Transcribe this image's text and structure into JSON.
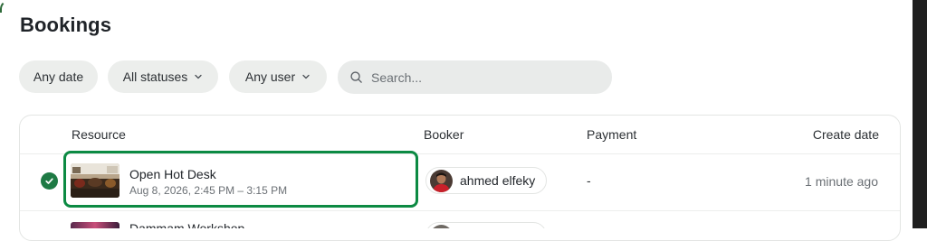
{
  "page": {
    "title": "Bookings"
  },
  "filters": {
    "date_label": "Any date",
    "status_label": "All statuses",
    "user_label": "Any user",
    "search_placeholder": "Search...",
    "search_value": ""
  },
  "table": {
    "headers": {
      "resource": "Resource",
      "booker": "Booker",
      "payment": "Payment",
      "create_date": "Create date"
    },
    "rows": [
      {
        "status": "confirmed",
        "resource_name": "Open Hot Desk",
        "time": "Aug 8, 2026, 2:45 PM – 3:15 PM",
        "booker": "ahmed elfeky",
        "payment": "-",
        "created": "1 minute ago"
      },
      {
        "resource_name": "Dammam Workshop"
      }
    ]
  },
  "colors": {
    "accent_green": "#0c8a43",
    "status_green": "#1e7a44",
    "chip_bg": "#eceeec"
  },
  "icons": {
    "status": "check-circle-icon",
    "search": "search-icon",
    "dropdown": "chevron-down-icon"
  }
}
